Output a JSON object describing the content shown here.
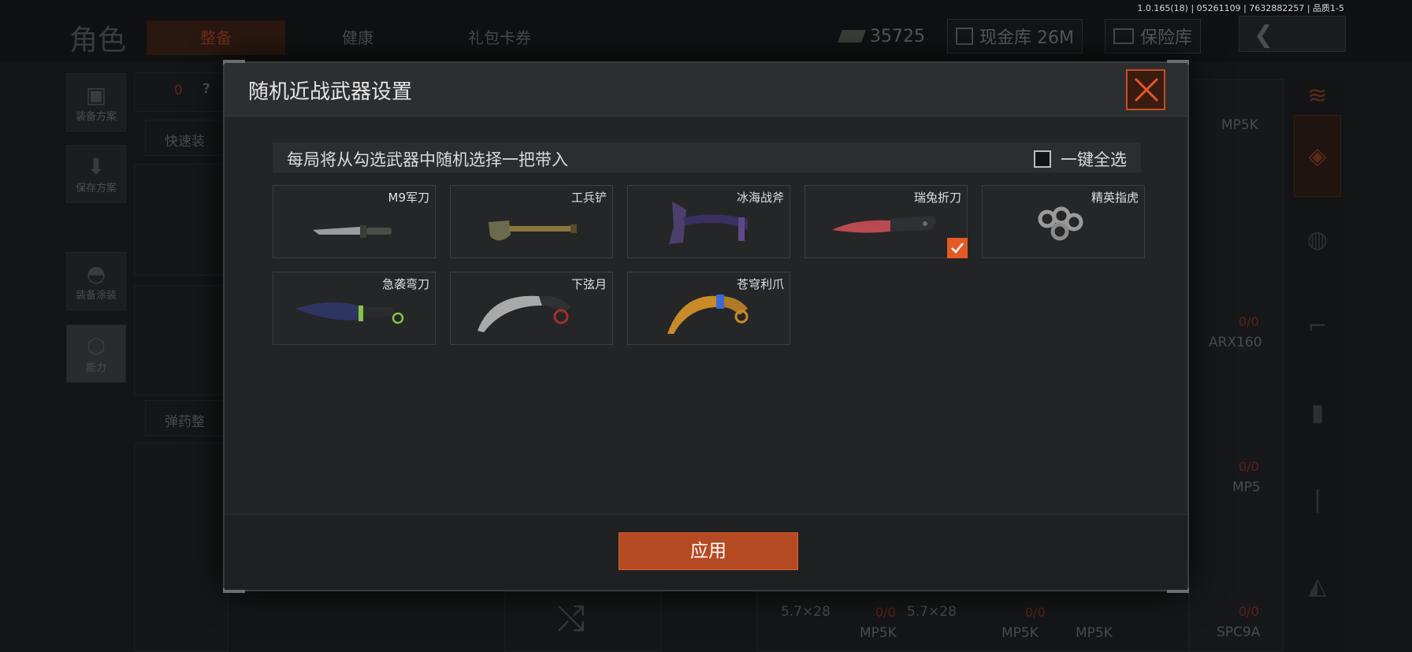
{
  "status": {
    "version_text": "1.0.165(18) | 05261109 | 7632882257 | 品质1-5"
  },
  "header": {
    "title": "角色",
    "tabs": [
      {
        "label": "整备",
        "active": true
      },
      {
        "label": "健康",
        "active": false
      },
      {
        "label": "礼包卡券",
        "active": false
      }
    ],
    "currency": {
      "value": "35725"
    },
    "cash_vault": {
      "label": "现金库 26M"
    },
    "safe_vault": {
      "label": "保险库"
    }
  },
  "left_sidebar": {
    "items": [
      {
        "label": "装备方案",
        "icon": "vest-icon"
      },
      {
        "label": "保存方案",
        "icon": "download-icon"
      },
      {
        "label": "装备涂装",
        "icon": "helmet-icon"
      },
      {
        "label": "能力",
        "icon": "ability-icon"
      }
    ],
    "count": "0",
    "help": "?",
    "quick_equip": "快速装",
    "ammo_sort": "弹药整"
  },
  "background_right": {
    "labels": [
      "MP5K",
      "ARX160",
      "MP5",
      "SPC9A",
      "MP5K",
      "MP5K",
      "MP5K"
    ],
    "ammo": [
      "5.7×28",
      "5.7×28"
    ],
    "counts": [
      "0/0",
      "0/0",
      "0/0",
      "0/0",
      "0/0"
    ]
  },
  "modal": {
    "title": "随机近战武器设置",
    "info_text": "每局将从勾选武器中随机选择一把带入",
    "select_all_label": "一键全选",
    "select_all_checked": false,
    "apply_label": "应用",
    "weapons": [
      {
        "name": "M9军刀",
        "icon": "bayonet-icon",
        "checked": false
      },
      {
        "name": "工兵铲",
        "icon": "shovel-icon",
        "checked": false
      },
      {
        "name": "冰海战斧",
        "icon": "axe-icon",
        "checked": false
      },
      {
        "name": "瑞兔折刀",
        "icon": "folding-knife-icon",
        "checked": true
      },
      {
        "name": "精英指虎",
        "icon": "knuckles-icon",
        "checked": false
      },
      {
        "name": "急袭弯刀",
        "icon": "machete-icon",
        "checked": false
      },
      {
        "name": "下弦月",
        "icon": "karambit-icon",
        "checked": false
      },
      {
        "name": "苍穹利爪",
        "icon": "claw-icon",
        "checked": false
      }
    ]
  },
  "colors": {
    "accent": "#e35a24",
    "apply_bg": "#b54a22",
    "modal_bg": "#232425"
  }
}
